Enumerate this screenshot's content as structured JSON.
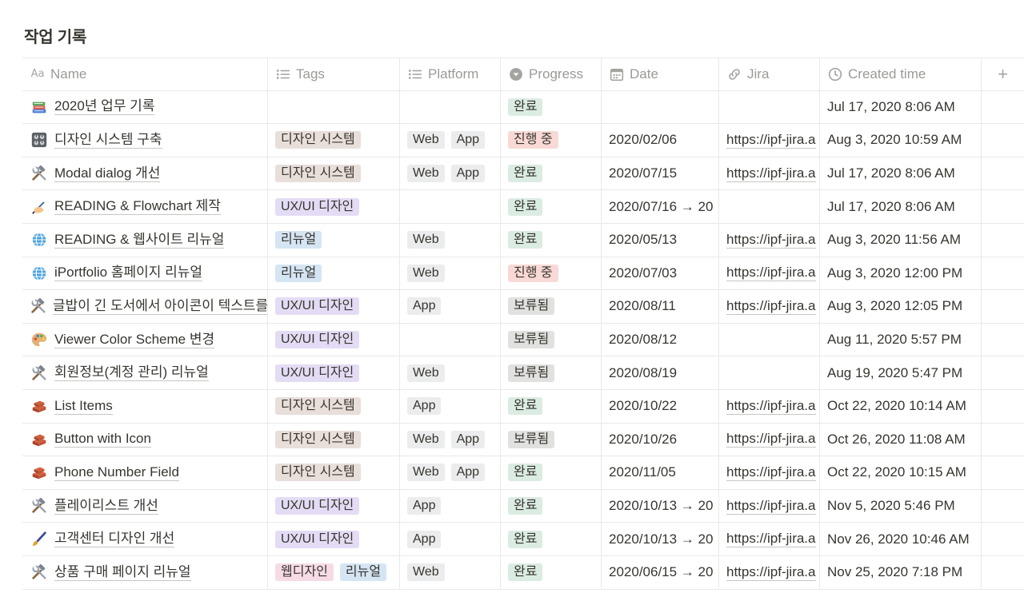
{
  "page": {
    "title": "작업 기록"
  },
  "columns": {
    "name": "Name",
    "tags": "Tags",
    "platform": "Platform",
    "progress": "Progress",
    "date": "Date",
    "jira": "Jira",
    "created": "Created time",
    "add": "+"
  },
  "colors": {
    "tag_brown": "#e8deda",
    "tag_purple": "#e4dcf5",
    "tag_blue": "#d6e5f3",
    "tag_pink": "#f6dbe6",
    "tag_gray": "#ebeced",
    "progress_green": "#dbece3",
    "progress_red": "#f9d9d6",
    "progress_gray": "#e1e1df"
  },
  "rows": [
    {
      "icon": "books-icon",
      "name": "2020년 업무 기록",
      "tags": [],
      "platform": [],
      "progress": {
        "label": "완료",
        "color": "green"
      },
      "date": "",
      "jira": "",
      "created": "Jul 17, 2020 8:06 AM"
    },
    {
      "icon": "control-knobs-icon",
      "name": "디자인 시스템 구축",
      "tags": [
        {
          "label": "디자인 시스템",
          "color": "brown"
        }
      ],
      "platform": [
        "Web",
        "App"
      ],
      "progress": {
        "label": "진행 중",
        "color": "red"
      },
      "date": "2020/02/06",
      "jira": "https://ipf-jira.a",
      "created": "Aug 3, 2020 10:59 AM"
    },
    {
      "icon": "hammer-wrench-icon",
      "name": "Modal dialog 개선",
      "tags": [
        {
          "label": "디자인 시스템",
          "color": "brown"
        }
      ],
      "platform": [
        "Web",
        "App"
      ],
      "progress": {
        "label": "완료",
        "color": "green"
      },
      "date": "2020/07/15",
      "jira": "https://ipf-jira.a",
      "created": "Jul 17, 2020 8:06 AM"
    },
    {
      "icon": "writing-hand-icon",
      "name": "READING & Flowchart 제작",
      "tags": [
        {
          "label": "UX/UI 디자인",
          "color": "purple"
        }
      ],
      "platform": [],
      "progress": {
        "label": "완료",
        "color": "green"
      },
      "date": "2020/07/16 → 20",
      "jira": "",
      "created": "Jul 17, 2020 8:06 AM"
    },
    {
      "icon": "globe-icon",
      "name": "READING & 웹사이트 리뉴얼",
      "tags": [
        {
          "label": "리뉴얼",
          "color": "blue"
        }
      ],
      "platform": [
        "Web"
      ],
      "progress": {
        "label": "완료",
        "color": "green"
      },
      "date": "2020/05/13",
      "jira": "https://ipf-jira.a",
      "created": "Aug 3, 2020 11:56 AM"
    },
    {
      "icon": "globe-icon",
      "name": "iPortfolio 홈페이지 리뉴얼",
      "tags": [
        {
          "label": "리뉴얼",
          "color": "blue"
        }
      ],
      "platform": [
        "Web"
      ],
      "progress": {
        "label": "진행 중",
        "color": "red"
      },
      "date": "2020/07/03",
      "jira": "https://ipf-jira.a",
      "created": "Aug 3, 2020 12:00 PM"
    },
    {
      "icon": "hammer-wrench-icon",
      "name": "글밥이 긴 도서에서 아이콘이 텍스트를",
      "tags": [
        {
          "label": "UX/UI 디자인",
          "color": "purple"
        }
      ],
      "platform": [
        "App"
      ],
      "progress": {
        "label": "보류됨",
        "color": "gray"
      },
      "date": "2020/08/11",
      "jira": "https://ipf-jira.a",
      "created": "Aug 3, 2020 12:05 PM"
    },
    {
      "icon": "palette-icon",
      "name": "Viewer Color Scheme 변경",
      "tags": [
        {
          "label": "UX/UI 디자인",
          "color": "purple"
        }
      ],
      "platform": [],
      "progress": {
        "label": "보류됨",
        "color": "gray"
      },
      "date": "2020/08/12",
      "jira": "",
      "created": "Aug 11, 2020 5:57 PM"
    },
    {
      "icon": "hammer-wrench-icon",
      "name": "회원정보(계정 관리) 리뉴얼",
      "tags": [
        {
          "label": "UX/UI 디자인",
          "color": "purple"
        }
      ],
      "platform": [
        "Web"
      ],
      "progress": {
        "label": "보류됨",
        "color": "gray"
      },
      "date": "2020/08/19",
      "jira": "",
      "created": "Aug 19, 2020 5:47 PM"
    },
    {
      "icon": "bricks-icon",
      "name": "List Items",
      "tags": [
        {
          "label": "디자인 시스템",
          "color": "brown"
        }
      ],
      "platform": [
        "App"
      ],
      "progress": {
        "label": "완료",
        "color": "green"
      },
      "date": "2020/10/22",
      "jira": "https://ipf-jira.a",
      "created": "Oct 22, 2020 10:14 AM"
    },
    {
      "icon": "bricks-icon",
      "name": "Button with Icon",
      "tags": [
        {
          "label": "디자인 시스템",
          "color": "brown"
        }
      ],
      "platform": [
        "Web",
        "App"
      ],
      "progress": {
        "label": "보류됨",
        "color": "gray"
      },
      "date": "2020/10/26",
      "jira": "https://ipf-jira.a",
      "created": "Oct 26, 2020 11:08 AM"
    },
    {
      "icon": "bricks-icon",
      "name": "Phone Number Field",
      "tags": [
        {
          "label": "디자인 시스템",
          "color": "brown"
        }
      ],
      "platform": [
        "Web",
        "App"
      ],
      "progress": {
        "label": "완료",
        "color": "green"
      },
      "date": "2020/11/05",
      "jira": "https://ipf-jira.a",
      "created": "Oct 22, 2020 10:15 AM"
    },
    {
      "icon": "hammer-wrench-icon",
      "name": "플레이리스트 개선",
      "tags": [
        {
          "label": "UX/UI 디자인",
          "color": "purple"
        }
      ],
      "platform": [
        "App"
      ],
      "progress": {
        "label": "완료",
        "color": "green"
      },
      "date": "2020/10/13 → 20",
      "jira": "https://ipf-jira.a",
      "created": "Nov 5, 2020 5:46 PM"
    },
    {
      "icon": "paintbrush-icon",
      "name": "고객센터 디자인 개선",
      "tags": [
        {
          "label": "UX/UI 디자인",
          "color": "purple"
        }
      ],
      "platform": [
        "App"
      ],
      "progress": {
        "label": "완료",
        "color": "green"
      },
      "date": "2020/10/13 → 20",
      "jira": "https://ipf-jira.a",
      "created": "Nov 26, 2020 10:46 AM"
    },
    {
      "icon": "hammer-wrench-icon",
      "name": "상품 구매 페이지 리뉴얼",
      "tags": [
        {
          "label": "웹디자인",
          "color": "pink"
        },
        {
          "label": "리뉴얼",
          "color": "blue"
        }
      ],
      "platform": [
        "Web"
      ],
      "progress": {
        "label": "완료",
        "color": "green"
      },
      "date": "2020/06/15 → 20",
      "jira": "https://ipf-jira.a",
      "created": "Nov 25, 2020 7:18 PM"
    }
  ]
}
